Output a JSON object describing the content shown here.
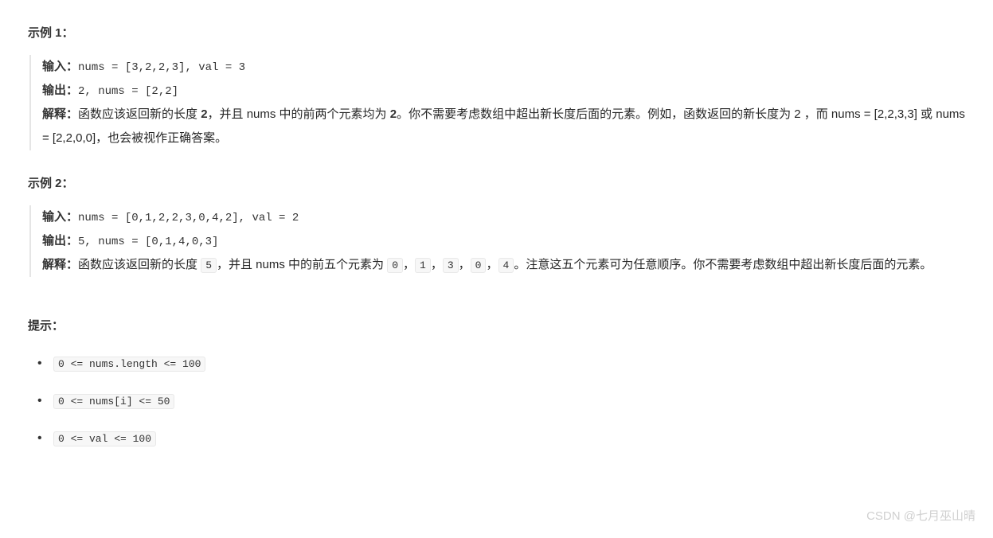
{
  "examples": [
    {
      "heading": "示例 1：",
      "input_label": "输入：",
      "input_value": "nums = [3,2,2,3], val = 3",
      "output_label": "输出：",
      "output_value": "2, nums = [2,2]",
      "explain_label": "解释：",
      "explain_parts": [
        {
          "type": "text",
          "value": "函数应该返回新的长度 "
        },
        {
          "type": "bold",
          "value": "2"
        },
        {
          "type": "text",
          "value": "，并且 nums 中的前两个元素均为 "
        },
        {
          "type": "bold",
          "value": "2"
        },
        {
          "type": "text",
          "value": "。你不需要考虑数组中超出新长度后面的元素。例如，函数返回的新长度为 2 ，而 nums = [2,2,3,3] 或 nums = [2,2,0,0]，也会被视作正确答案。"
        }
      ]
    },
    {
      "heading": "示例 2：",
      "input_label": "输入：",
      "input_value": "nums = [0,1,2,2,3,0,4,2], val = 2",
      "output_label": "输出：",
      "output_value": "5, nums = [0,1,4,0,3]",
      "explain_label": "解释：",
      "explain_parts": [
        {
          "type": "text",
          "value": "函数应该返回新的长度 "
        },
        {
          "type": "code",
          "value": "5"
        },
        {
          "type": "text",
          "value": "，并且 nums 中的前五个元素为 "
        },
        {
          "type": "code",
          "value": "0"
        },
        {
          "type": "text",
          "value": "，"
        },
        {
          "type": "code",
          "value": "1"
        },
        {
          "type": "text",
          "value": "，"
        },
        {
          "type": "code",
          "value": "3"
        },
        {
          "type": "text",
          "value": "，"
        },
        {
          "type": "code",
          "value": "0"
        },
        {
          "type": "text",
          "value": "，"
        },
        {
          "type": "code",
          "value": "4"
        },
        {
          "type": "text",
          "value": "。注意这五个元素可为任意顺序。你不需要考虑数组中超出新长度后面的元素。"
        }
      ]
    }
  ],
  "hints": {
    "heading": "提示：",
    "items": [
      "0 <= nums.length <= 100",
      "0 <= nums[i] <= 50",
      "0 <= val <= 100"
    ]
  },
  "watermark": "CSDN @七月巫山晴"
}
